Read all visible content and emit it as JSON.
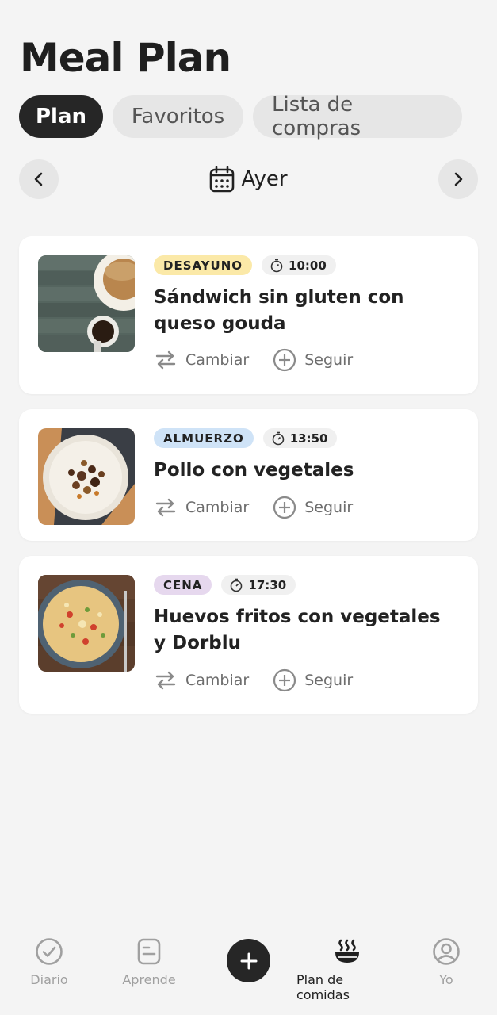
{
  "header": {
    "title": "Meal Plan"
  },
  "tabs": [
    {
      "label": "Plan",
      "active": true
    },
    {
      "label": "Favoritos",
      "active": false
    },
    {
      "label": "Lista de compras",
      "active": false
    }
  ],
  "date_bar": {
    "label": "Ayer"
  },
  "meals": [
    {
      "badge": "DESAYUNO",
      "badge_color": "#fbe9a8",
      "time": "10:00",
      "title": "Sándwich sin gluten con queso gouda",
      "change_label": "Cambiar",
      "follow_label": "Seguir"
    },
    {
      "badge": "ALMUERZO",
      "badge_color": "#cfe3f7",
      "time": "13:50",
      "title": "Pollo con vegetales",
      "change_label": "Cambiar",
      "follow_label": "Seguir"
    },
    {
      "badge": "CENA",
      "badge_color": "#e6d8ee",
      "time": "17:30",
      "title": "Huevos fritos con vegetales y Dorblu",
      "change_label": "Cambiar",
      "follow_label": "Seguir"
    }
  ],
  "bottom_nav": [
    {
      "label": "Diario",
      "icon": "check-circle-icon",
      "active": false
    },
    {
      "label": "Aprende",
      "icon": "notes-icon",
      "active": false
    },
    {
      "label": "",
      "icon": "plus-icon",
      "active": false
    },
    {
      "label": "Plan de comidas",
      "icon": "bowl-icon",
      "active": true
    },
    {
      "label": "Yo",
      "icon": "profile-icon",
      "active": false
    }
  ]
}
